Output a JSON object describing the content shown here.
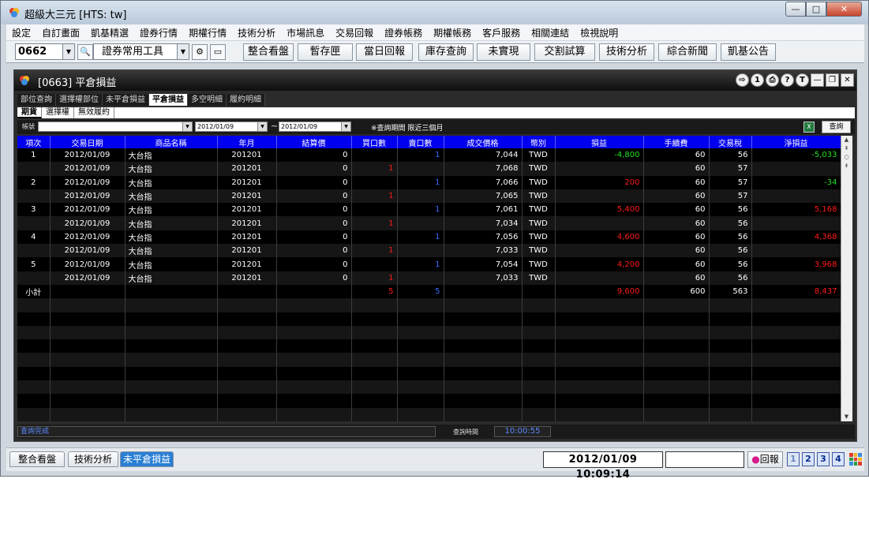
{
  "window": {
    "title": "超級大三元  [HTS: tw]",
    "buttons": {
      "min": "—",
      "max": "□",
      "close": "✕"
    }
  },
  "menu": [
    "設定",
    "自訂畫面",
    "凱基精選",
    "證券行情",
    "期權行情",
    "技術分析",
    "市場訊息",
    "交易回報",
    "證券帳務",
    "期權帳務",
    "客戶服務",
    "相關連結",
    "檢視說明"
  ],
  "toolbar": {
    "code": "0662",
    "tool_select": "證券常用工具",
    "buttons": [
      "整合看盤",
      "暫存匣",
      "當日回報",
      "庫存查詢",
      "未實現",
      "交割試算",
      "技術分析",
      "綜合新聞",
      "凱基公告"
    ]
  },
  "inner": {
    "title": "[0663] 平倉損益",
    "circle_buttons": [
      "⇨",
      "1",
      "⎙",
      "?",
      "T"
    ],
    "tabs": [
      "部位查詢",
      "選擇權部位",
      "未平倉損益",
      "平倉損益",
      "多空明細",
      "履約明細"
    ],
    "active_tab": 3,
    "subtabs": [
      "期貨",
      "選擇權",
      "無效履約"
    ],
    "active_subtab": 0,
    "filter": {
      "label": "帳號",
      "date_from": "2012/01/09",
      "tilde": "~",
      "date_to": "2012/01/09",
      "note": "※查詢期間 限近三個月",
      "excel_icon": "X",
      "query_button": "查詢"
    },
    "columns": [
      "項次",
      "交易日期",
      "商品名稱",
      "年月",
      "結算價",
      "買口數",
      "賣口數",
      "成交價格",
      "幣別",
      "損益",
      "手續費",
      "交易稅",
      "淨損益"
    ],
    "rows": [
      {
        "no": "1",
        "date": "2012/01/09",
        "name": "大台指",
        "ym": "201201",
        "settle": "0",
        "buy": "",
        "sell": "1",
        "price": "7,044",
        "cur": "TWD",
        "pl": "-4,800",
        "fee": "60",
        "tax": "56",
        "net": "-5,033"
      },
      {
        "no": "",
        "date": "2012/01/09",
        "name": "大台指",
        "ym": "201201",
        "settle": "0",
        "buy": "1",
        "sell": "",
        "price": "7,068",
        "cur": "TWD",
        "pl": "",
        "fee": "60",
        "tax": "57",
        "net": ""
      },
      {
        "no": "2",
        "date": "2012/01/09",
        "name": "大台指",
        "ym": "201201",
        "settle": "0",
        "buy": "",
        "sell": "1",
        "price": "7,066",
        "cur": "TWD",
        "pl": "200",
        "fee": "60",
        "tax": "57",
        "net": "-34"
      },
      {
        "no": "",
        "date": "2012/01/09",
        "name": "大台指",
        "ym": "201201",
        "settle": "0",
        "buy": "1",
        "sell": "",
        "price": "7,065",
        "cur": "TWD",
        "pl": "",
        "fee": "60",
        "tax": "57",
        "net": ""
      },
      {
        "no": "3",
        "date": "2012/01/09",
        "name": "大台指",
        "ym": "201201",
        "settle": "0",
        "buy": "",
        "sell": "1",
        "price": "7,061",
        "cur": "TWD",
        "pl": "5,400",
        "fee": "60",
        "tax": "56",
        "net": "5,168"
      },
      {
        "no": "",
        "date": "2012/01/09",
        "name": "大台指",
        "ym": "201201",
        "settle": "0",
        "buy": "1",
        "sell": "",
        "price": "7,034",
        "cur": "TWD",
        "pl": "",
        "fee": "60",
        "tax": "56",
        "net": ""
      },
      {
        "no": "4",
        "date": "2012/01/09",
        "name": "大台指",
        "ym": "201201",
        "settle": "0",
        "buy": "",
        "sell": "1",
        "price": "7,056",
        "cur": "TWD",
        "pl": "4,600",
        "fee": "60",
        "tax": "56",
        "net": "4,368"
      },
      {
        "no": "",
        "date": "2012/01/09",
        "name": "大台指",
        "ym": "201201",
        "settle": "0",
        "buy": "1",
        "sell": "",
        "price": "7,033",
        "cur": "TWD",
        "pl": "",
        "fee": "60",
        "tax": "56",
        "net": ""
      },
      {
        "no": "5",
        "date": "2012/01/09",
        "name": "大台指",
        "ym": "201201",
        "settle": "0",
        "buy": "",
        "sell": "1",
        "price": "7,054",
        "cur": "TWD",
        "pl": "4,200",
        "fee": "60",
        "tax": "56",
        "net": "3,968"
      },
      {
        "no": "",
        "date": "2012/01/09",
        "name": "大台指",
        "ym": "201201",
        "settle": "0",
        "buy": "1",
        "sell": "",
        "price": "7,033",
        "cur": "TWD",
        "pl": "",
        "fee": "60",
        "tax": "56",
        "net": ""
      }
    ],
    "subtotal": {
      "label": "小計",
      "buy": "5",
      "sell": "5",
      "pl": "9,600",
      "fee": "600",
      "tax": "563",
      "net": "8,437"
    },
    "empty_rows": 9,
    "status": {
      "text": "查詢完成",
      "time_label": "查詢時間",
      "time": "10:00:55"
    }
  },
  "bottom": {
    "tabs": [
      "整合看盤",
      "技術分析",
      "未平倉損益"
    ],
    "active_tab": 2,
    "datetime": "2012/01/09 10:09:14",
    "reply": "回報",
    "screen_buttons": [
      "1",
      "2",
      "3",
      "4"
    ]
  },
  "colors": {
    "header_blue": "#0000ee",
    "profit": "#ff1a1a",
    "loss": "#22e022",
    "qty_blue": "#3b6bff"
  }
}
